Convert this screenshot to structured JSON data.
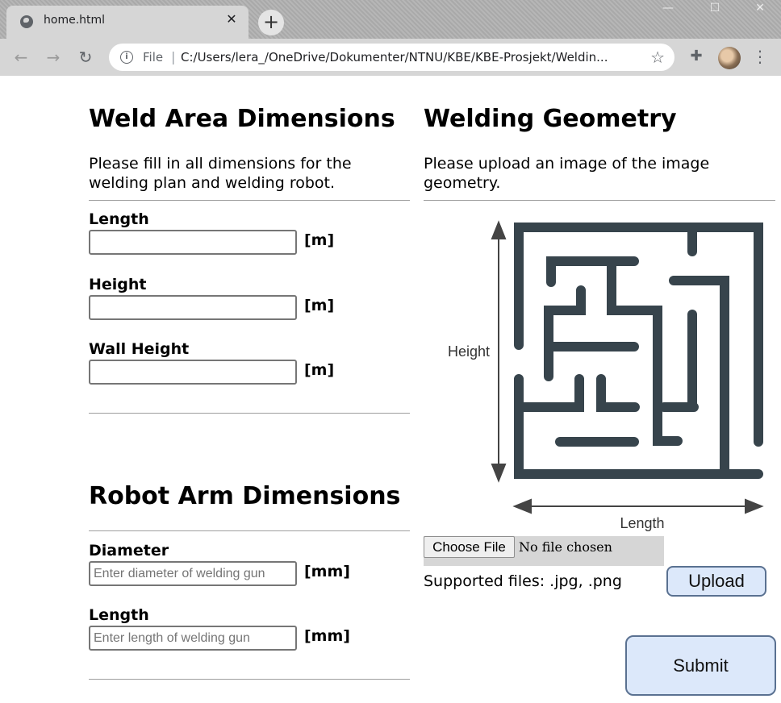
{
  "browser": {
    "tab_title": "home.html",
    "tab_close": "✕",
    "new_tab": "+",
    "address_scheme": "File",
    "address_separator": "|",
    "address_url": "C:/Users/lera_/OneDrive/Dokumenter/NTNU/KBE/KBE-Prosjekt/Weldin...",
    "window_controls": [
      "—",
      "☐",
      "✕"
    ]
  },
  "weld_area": {
    "title": "Weld Area Dimensions",
    "description": "Please fill in all dimensions for the welding plan and welding robot.",
    "fields": [
      {
        "label": "Length",
        "unit": "[m]",
        "value": "",
        "placeholder": ""
      },
      {
        "label": "Height",
        "unit": "[m]",
        "value": "",
        "placeholder": ""
      },
      {
        "label": "Wall Height",
        "unit": "[m]",
        "value": "",
        "placeholder": ""
      }
    ]
  },
  "robot_arm": {
    "title": "Robot Arm Dimensions",
    "fields": [
      {
        "label": "Diameter",
        "unit": "[mm]",
        "value": "",
        "placeholder": "Enter diameter of welding gun"
      },
      {
        "label": "Length",
        "unit": "[mm]",
        "value": "",
        "placeholder": "Enter length of welding gun"
      }
    ]
  },
  "welding_geometry": {
    "title": "Welding Geometry",
    "description": "Please upload an image of the image geometry.",
    "image_labels": {
      "height": "Height",
      "length": "Length"
    },
    "file_button": "Choose File",
    "file_status": "No file chosen",
    "supported": "Supported files: .jpg, .png",
    "upload_label": "Upload"
  },
  "submit_label": "Submit",
  "colors": {
    "maze": "#37444c",
    "button_bg": "#dce8fa",
    "button_border": "#5a7191"
  }
}
